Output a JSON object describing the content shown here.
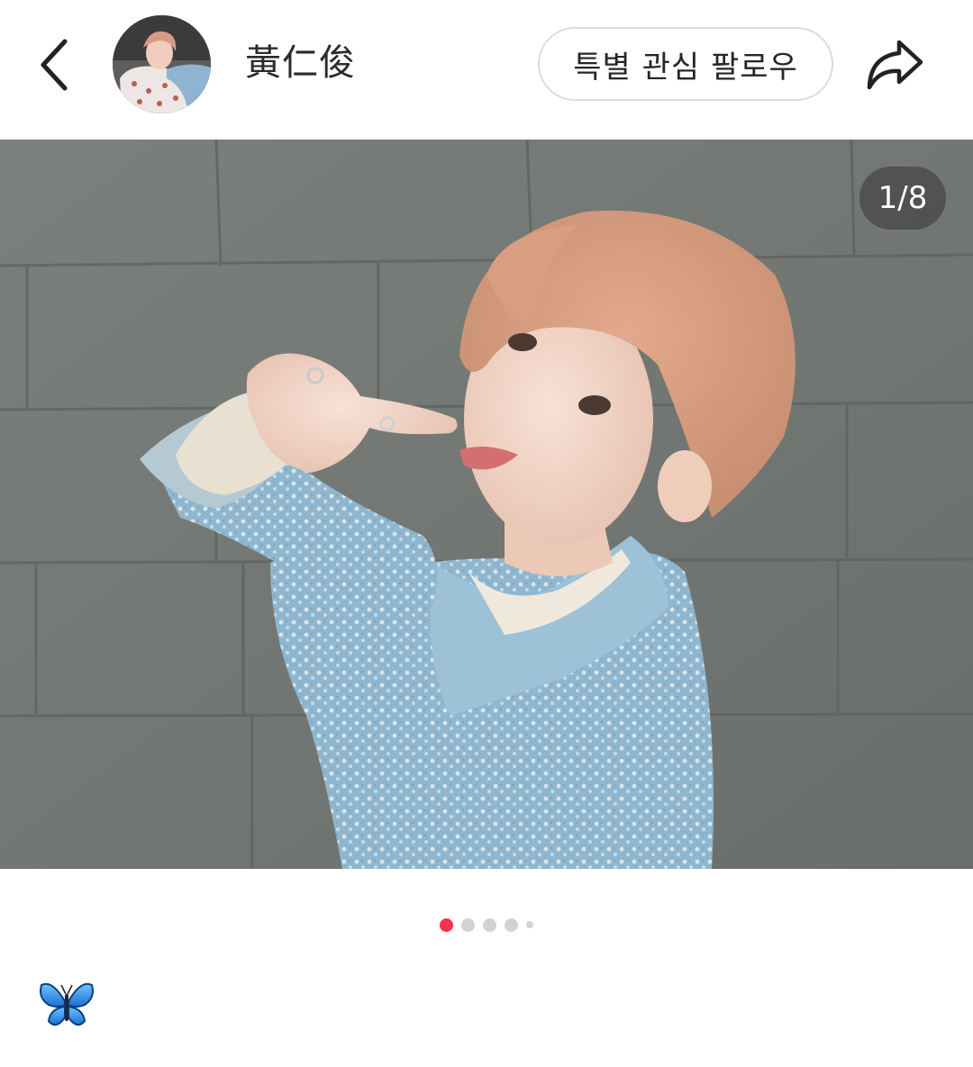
{
  "header": {
    "back_icon": "chevron-left-icon",
    "username": "黃仁俊",
    "follow_button_label": "특별 관심 팔로우",
    "share_icon": "share-arrow-icon"
  },
  "photo": {
    "counter": "1/8",
    "current_index": 1,
    "total": 8
  },
  "pagination": {
    "visible_dots": 5,
    "active_index": 0,
    "active_color": "#f3344f",
    "inactive_color": "#d2d2d2"
  },
  "caption": {
    "emoji_icon": "butterfly-icon"
  }
}
